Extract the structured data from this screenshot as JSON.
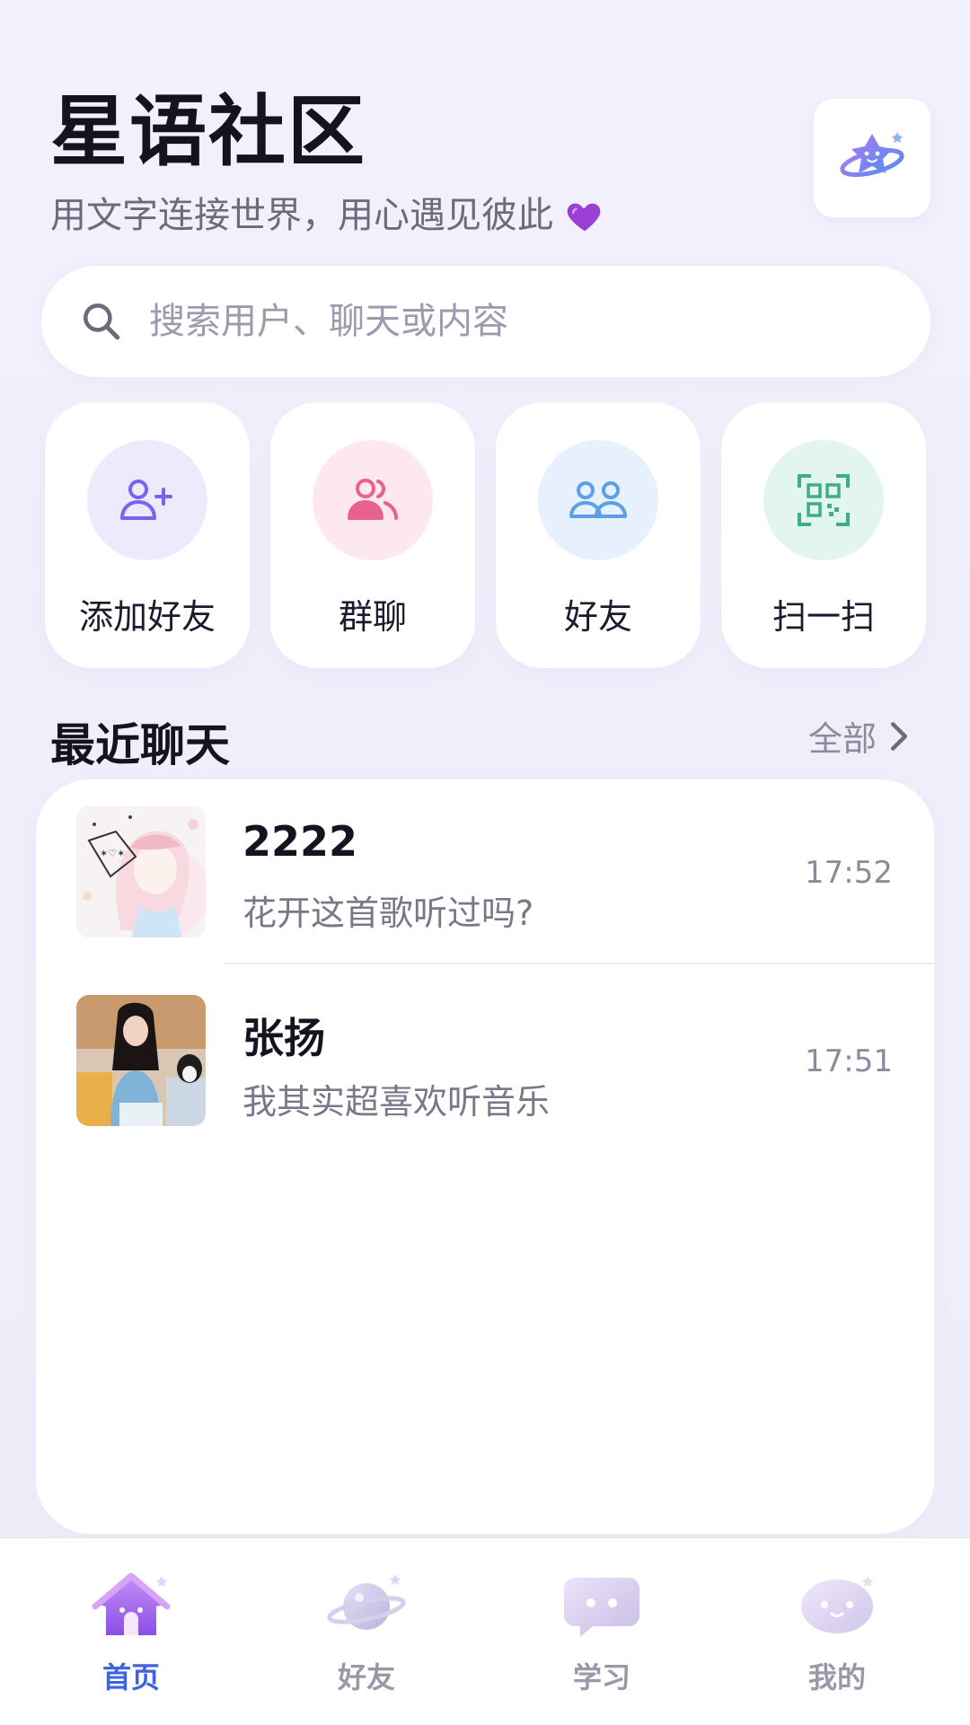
{
  "header": {
    "title": "星语社区",
    "subtitle": "用文字连接世界，用心遇见彼此",
    "heart_icon": "purple-heart-icon",
    "logo_icon": "star-planet-logo-icon"
  },
  "search": {
    "placeholder": "搜索用户、聊天或内容",
    "icon": "search-icon"
  },
  "quick_actions": [
    {
      "label": "添加好友",
      "icon": "add-user-icon",
      "color": "#7a63f0",
      "bg": "#eeeafd"
    },
    {
      "label": "群聊",
      "icon": "group-chat-icon",
      "color": "#e8628c",
      "bg": "#fde8ef"
    },
    {
      "label": "好友",
      "icon": "friends-icon",
      "color": "#5b9fe6",
      "bg": "#e6f1fd"
    },
    {
      "label": "扫一扫",
      "icon": "qr-scan-icon",
      "color": "#3fae84",
      "bg": "#e2f5ee"
    }
  ],
  "recent": {
    "title": "最近聊天",
    "see_all": "全部"
  },
  "chats": [
    {
      "name": "2222",
      "preview": "花开这首歌听过吗?",
      "time": "17:52",
      "avatar": "anime-girl-avatar"
    },
    {
      "name": "张扬",
      "preview": "我其实超喜欢听音乐",
      "time": "17:51",
      "avatar": "woman-photo-avatar"
    }
  ],
  "tabs": [
    {
      "label": "首页",
      "icon": "home-icon",
      "active": true
    },
    {
      "label": "好友",
      "icon": "planet-icon",
      "active": false
    },
    {
      "label": "学习",
      "icon": "chat-bubble-icon",
      "active": false
    },
    {
      "label": "我的",
      "icon": "profile-bubble-icon",
      "active": false
    }
  ],
  "colors": {
    "accent": "#3d63e0",
    "background": "#f2f0fb"
  }
}
